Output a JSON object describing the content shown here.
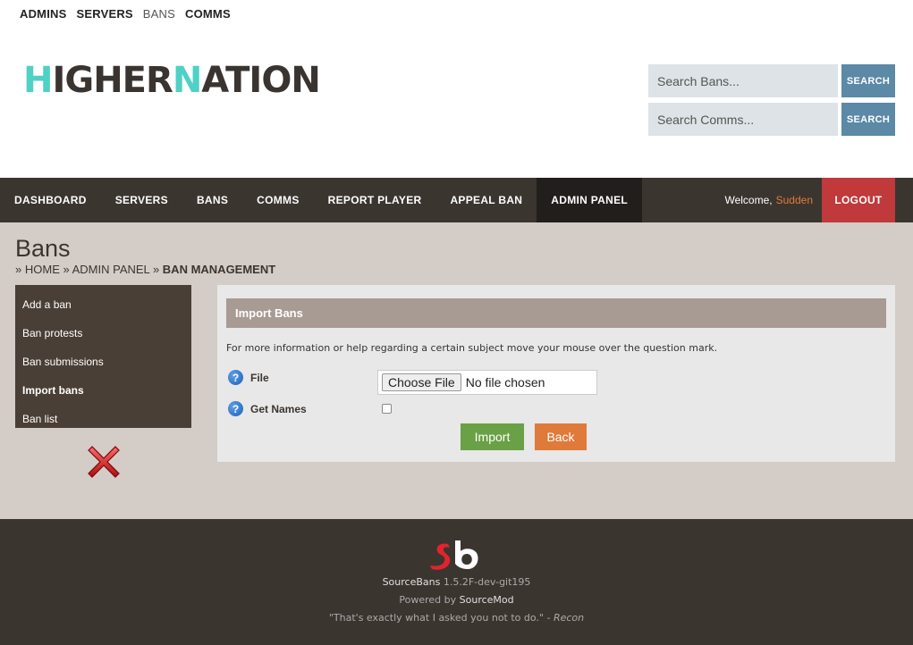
{
  "toplinks": [
    {
      "label": "ADMINS"
    },
    {
      "label": "SERVERS"
    },
    {
      "label": "BANS"
    },
    {
      "label": "COMMS"
    }
  ],
  "logo": {
    "part1": "H",
    "part2": "IGHER",
    "part3": "N",
    "part4": "ATION"
  },
  "search": {
    "bans_placeholder": "Search Bans...",
    "comms_placeholder": "Search Comms...",
    "button_label": "SEARCH"
  },
  "nav": {
    "items": [
      {
        "label": "DASHBOARD"
      },
      {
        "label": "SERVERS"
      },
      {
        "label": "BANS"
      },
      {
        "label": "COMMS"
      },
      {
        "label": "REPORT PLAYER"
      },
      {
        "label": "APPEAL BAN"
      },
      {
        "label": "ADMIN PANEL"
      }
    ],
    "welcome": "Welcome,",
    "username": "Sudden",
    "logout": "LOGOUT"
  },
  "page": {
    "title": "Bans",
    "breadcrumb": [
      "HOME",
      "ADMIN PANEL",
      "BAN MANAGEMENT"
    ],
    "sep": "»"
  },
  "sidemenu": [
    {
      "label": "Add a ban"
    },
    {
      "label": "Ban protests"
    },
    {
      "label": "Ban submissions"
    },
    {
      "label": "Import bans"
    },
    {
      "label": "Ban list"
    }
  ],
  "panel": {
    "title": "Import Bans",
    "info": "For more information or help regarding a certain subject move your mouse over the question mark.",
    "file_label": "File",
    "file_button": "Choose File",
    "file_status": "No file chosen",
    "names_label": "Get Names",
    "import": "Import",
    "back": "Back"
  },
  "footer": {
    "app": "SourceBans",
    "version": "1.5.2F-dev-git195",
    "powered": "Powered by",
    "powered_name": "SourceMod",
    "quote": "\"That's exactly what I asked you not to do.\" -",
    "quote_author": "Recon"
  },
  "colors": {
    "nav_bg": "#3b3530",
    "accent_teal": "#4fd1c5",
    "search_btn": "#5b89a6",
    "logout": "#c0393b",
    "import": "#6aa046",
    "back": "#df7a3a"
  }
}
